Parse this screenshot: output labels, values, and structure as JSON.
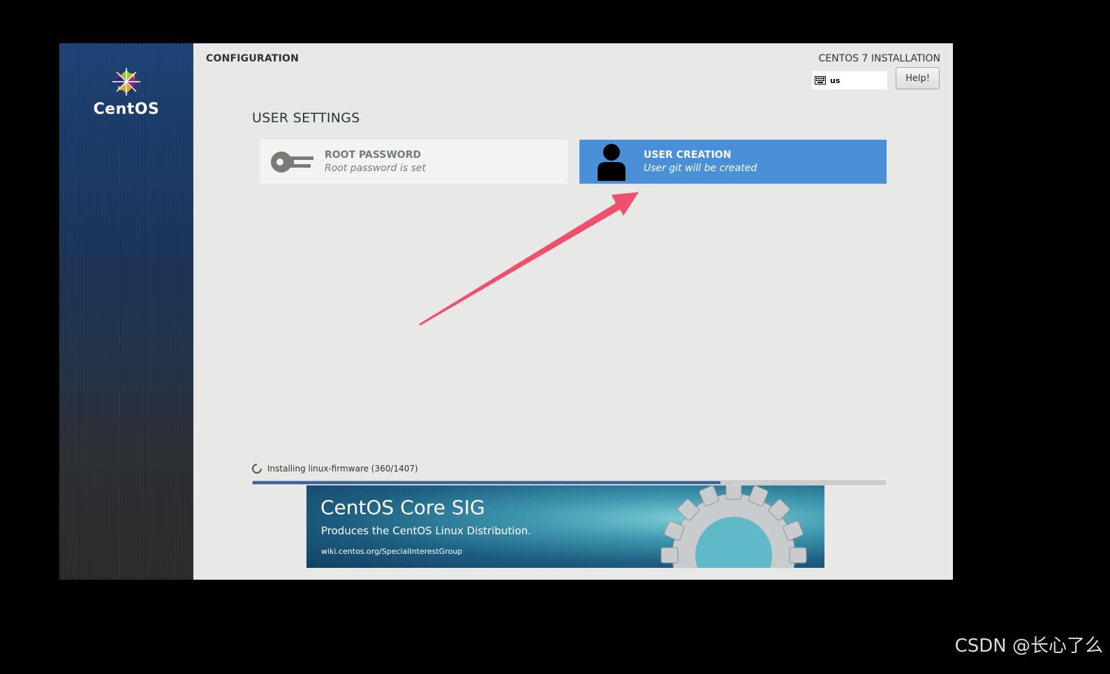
{
  "sidebar": {
    "logo_text": "CentOS",
    "logo_icon": "centos-logo-icon"
  },
  "header": {
    "config_title": "CONFIGURATION",
    "install_title": "CENTOS 7 INSTALLATION",
    "keyboard_layout": "us",
    "keyboard_icon": "keyboard-icon",
    "help_label": "Help!"
  },
  "section": {
    "title": "USER SETTINGS"
  },
  "spokes": [
    {
      "title": "ROOT PASSWORD",
      "status": "Root password is set",
      "icon": "key-icon"
    },
    {
      "title": "USER CREATION",
      "status": "User git will be created",
      "icon": "user-icon"
    }
  ],
  "progress": {
    "label": "Installing linux-firmware (360/1407)",
    "fraction": 0.74,
    "icon": "spinner-icon"
  },
  "banner": {
    "title": "CentOS Core SIG",
    "subtitle": "Produces the CentOS Linux Distribution.",
    "url": "wiki.centos.org/SpecialInterestGroup",
    "icon": "gear-icon"
  },
  "annotation": {
    "arrow_color": "#f0506e"
  },
  "watermark": "CSDN @长心了么",
  "colors": {
    "selected_spoke": "#4a90d9",
    "progress": "#3465a4",
    "background": "#e8e8e7"
  }
}
